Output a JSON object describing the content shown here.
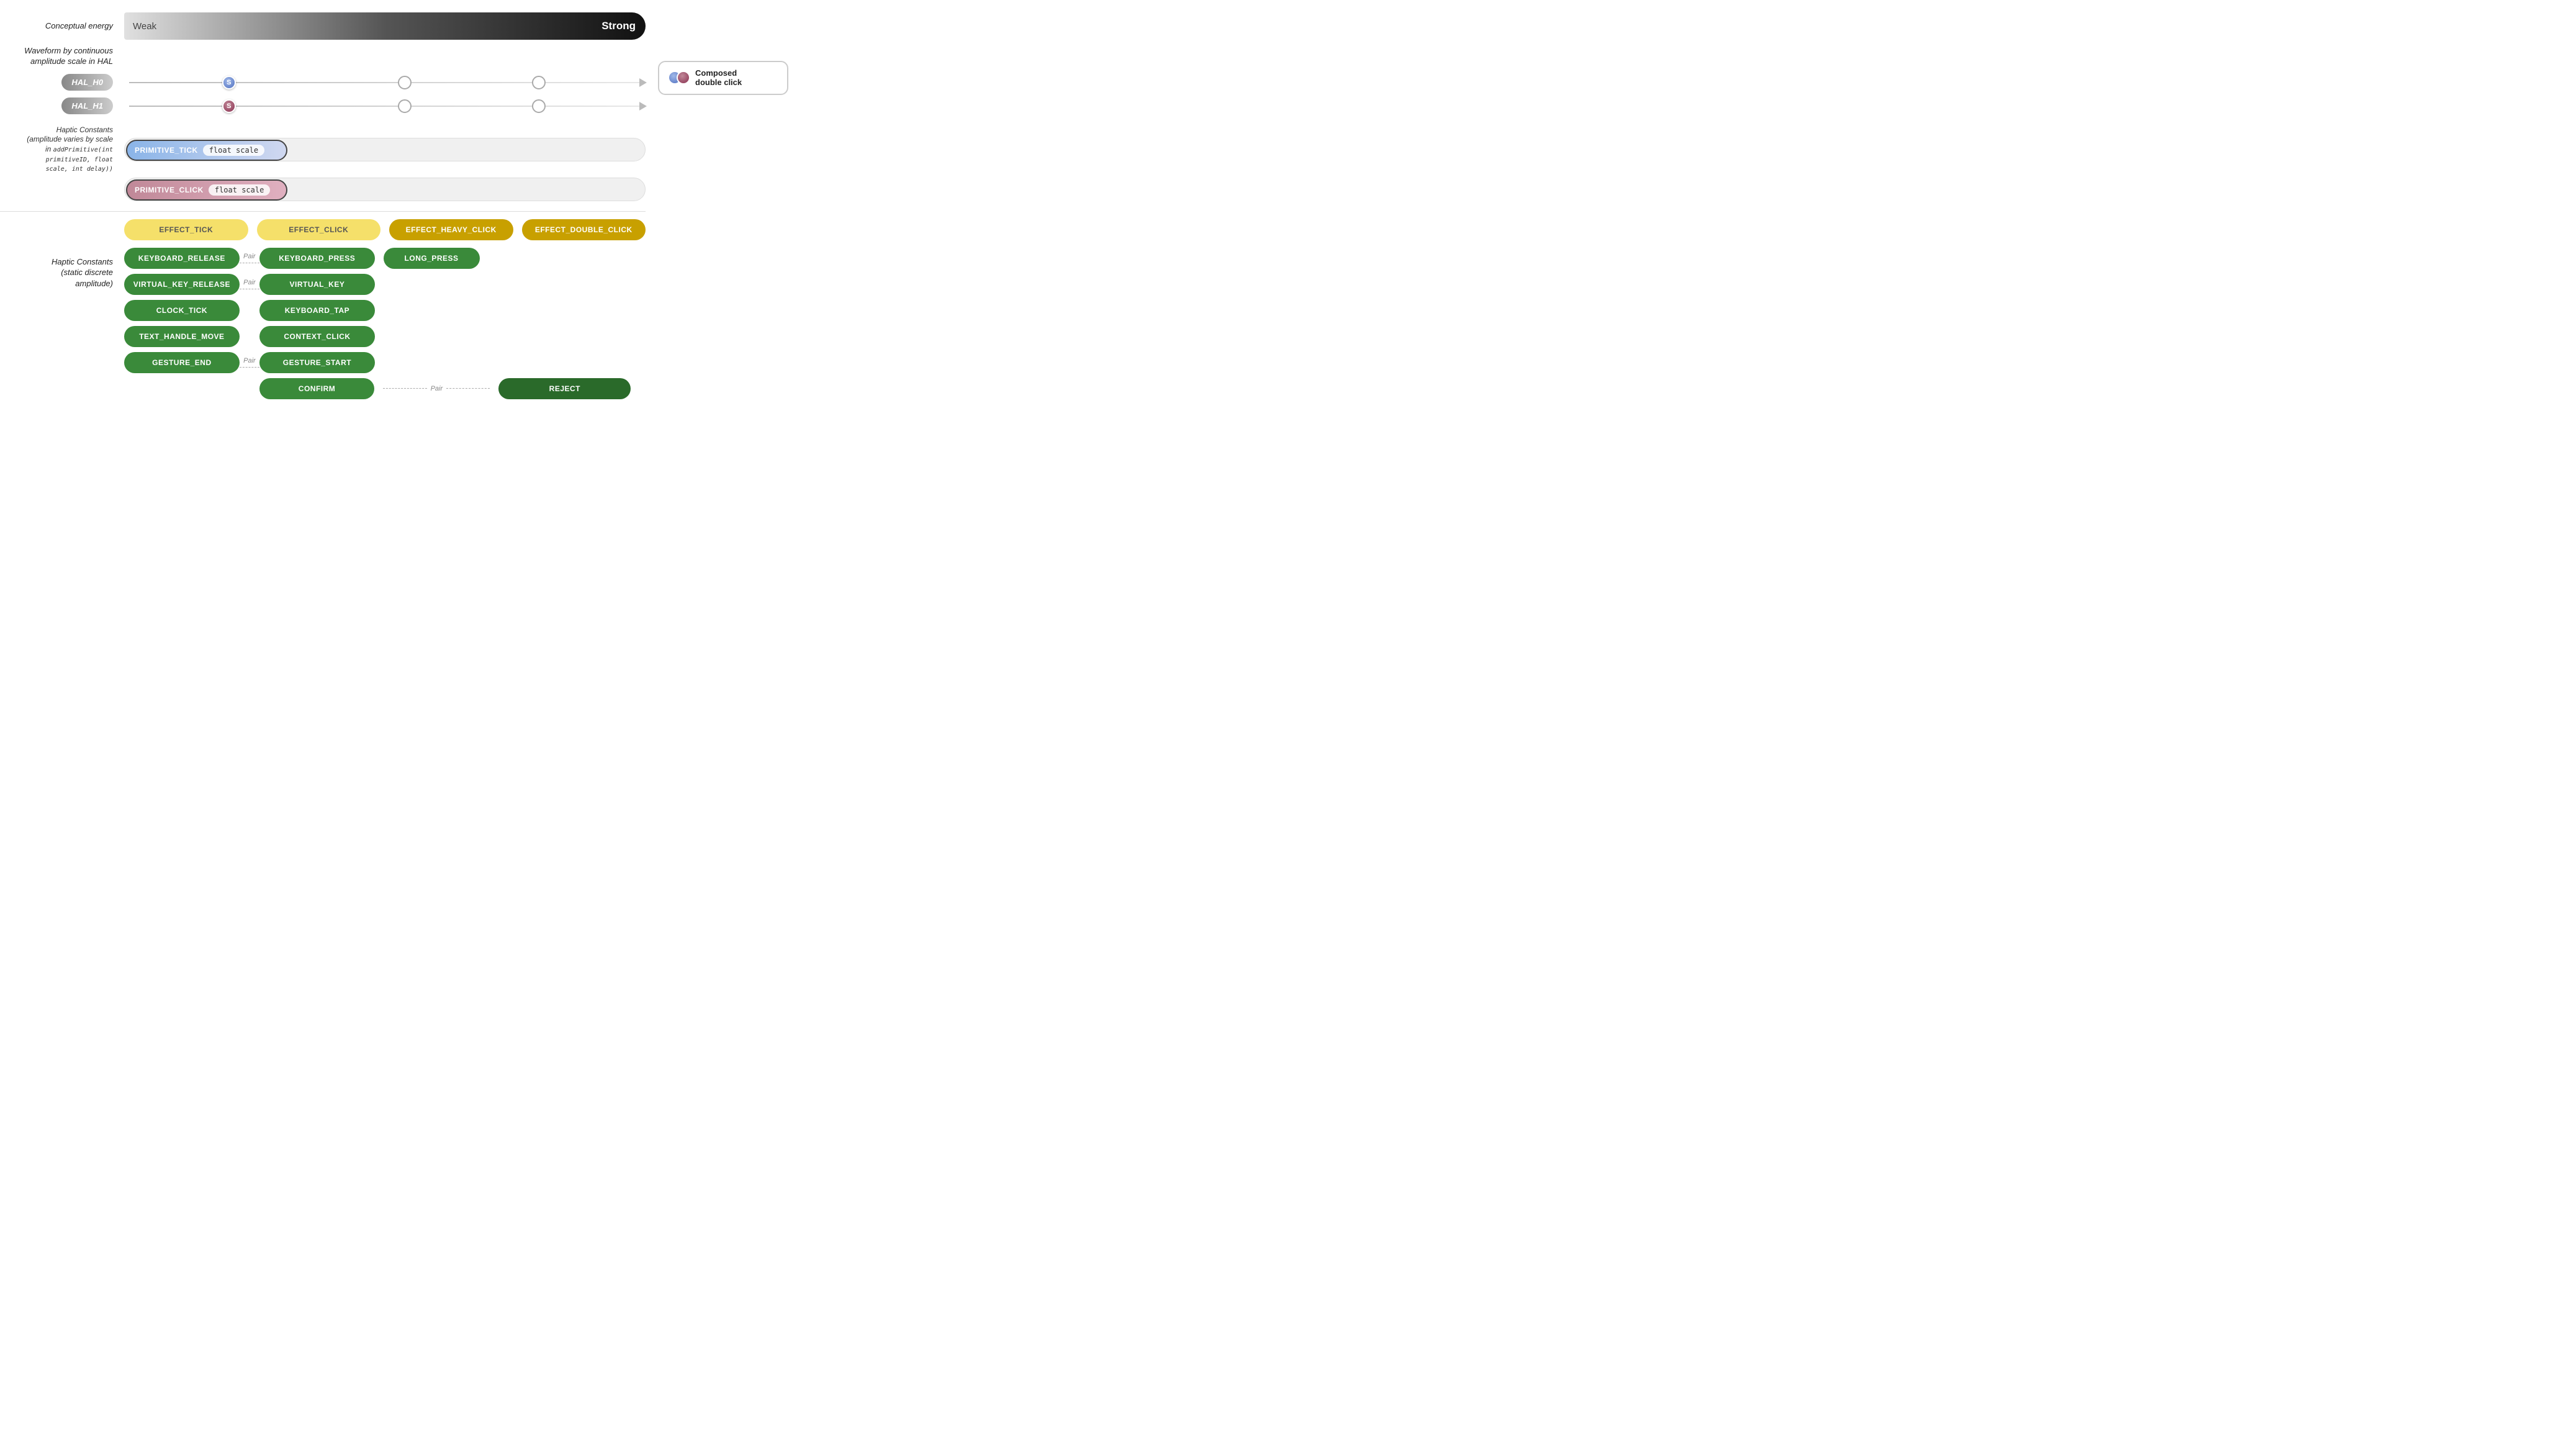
{
  "conceptual_energy": {
    "label": "Conceptual energy",
    "weak": "Weak",
    "strong": "Strong"
  },
  "waveform_label": "Waveform by continuous\namplitude scale in HAL",
  "hal": {
    "h0": {
      "label": "HAL_H0",
      "dot_label": "S"
    },
    "h1": {
      "label": "HAL_H1",
      "dot_label": "S"
    }
  },
  "composed_badge": {
    "text_line1": "Composed",
    "text_line2": "double click"
  },
  "primitives_label": "Haptic Constants\n(amplitude varies by scale\nin addPrimitive(int\nprimitiveID, float\nscale, int delay))",
  "primitives": [
    {
      "name": "PRIMITIVE_TICK",
      "scale_label": "float scale",
      "type": "tick"
    },
    {
      "name": "PRIMITIVE_CLICK",
      "scale_label": "float scale",
      "type": "click"
    }
  ],
  "haptic_constants_label": "Haptic Constants\n(static discrete\namplitude)",
  "effects_top": [
    {
      "label": "EFFECT_TICK",
      "style": "yellow-light"
    },
    {
      "label": "EFFECT_CLICK",
      "style": "yellow-light"
    },
    {
      "label": "EFFECT_HEAVY_CLICK",
      "style": "yellow-dark"
    },
    {
      "label": "EFFECT_DOUBLE_CLICK",
      "style": "yellow-dark"
    }
  ],
  "haptic_rows": [
    {
      "col1": "KEYBOARD_RELEASE",
      "pair_label": "Pair",
      "col2": "KEYBOARD_PRESS",
      "col3": "LONG_PRESS",
      "col3_style": "green-btn"
    },
    {
      "col1": "VIRTUAL_KEY_RELEASE",
      "pair_label": "Pair",
      "col2": "VIRTUAL_KEY",
      "col3": "",
      "col3_style": ""
    },
    {
      "col1": "CLOCK_TICK",
      "col2": "KEYBOARD_TAP",
      "pair_label": "",
      "col3": "",
      "col3_style": ""
    },
    {
      "col1": "TEXT_HANDLE_MOVE",
      "col2": "CONTEXT_CLICK",
      "pair_label": "",
      "col3": "",
      "col3_style": ""
    },
    {
      "col1": "GESTURE_END",
      "pair_label": "Pair",
      "col2": "GESTURE_START",
      "col3": "",
      "col3_style": ""
    },
    {
      "col1": "",
      "pair_label": "",
      "col2": "CONFIRM",
      "col3_pair_label": "Pair",
      "col4": "REJECT",
      "col3_style": "green-btn"
    }
  ]
}
